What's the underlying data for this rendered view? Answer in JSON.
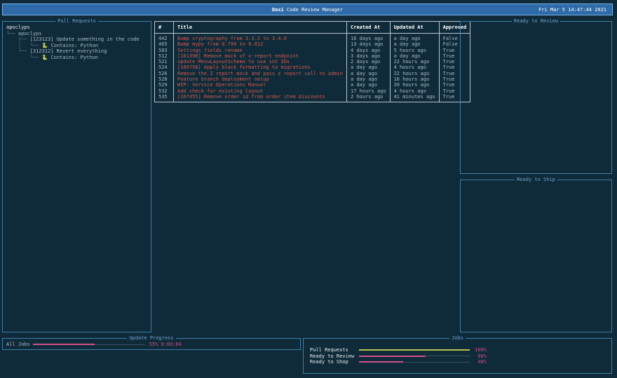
{
  "header": {
    "app_name": "Dexi",
    "subtitle": "Code Review Manager",
    "clock": "Fri Mar  5 14:47:44 2021"
  },
  "pull_requests_panel": {
    "title": "Pull Requests",
    "tree": {
      "root": "apoclyps",
      "repo": "apoclyps",
      "branches": [
        {
          "label": "[123123] Update something in the code",
          "contains": "Contains: Python"
        },
        {
          "label": "[312312] Revert everything",
          "contains": "Contains: Python"
        }
      ]
    }
  },
  "table": {
    "headers": [
      "#",
      "Title",
      "Created At",
      "Updated At",
      "Approved"
    ],
    "rows": [
      [
        "442",
        "Bump cryptography from 3.3.2 to 3.4.6",
        "16 days ago",
        "a day ago",
        "False"
      ],
      [
        "465",
        "Bump mypy from 0.790 to 0.812",
        "13 days ago",
        "a day ago",
        "False"
      ],
      [
        "503",
        "Settings fields rename",
        "4 days ago",
        "5 hours ago",
        "True"
      ],
      [
        "512",
        "[161398] Remove mock of x-report endpoint",
        "3 days ago",
        "a day ago",
        "True"
      ],
      [
        "521",
        "update MenuLayoutSchema to use int IDs",
        "2 days ago",
        "22 hours ago",
        "True"
      ],
      [
        "524",
        "[166758] Apply black formatting to migrations",
        "a day ago",
        "4 hours ago",
        "True"
      ],
      [
        "526",
        "Remove the Z report mock and pass z report call to admin",
        "a day ago",
        "22 hours ago",
        "True"
      ],
      [
        "528",
        "Feature branch deployment setup",
        "a day ago",
        "16 hours ago",
        "True"
      ],
      [
        "529",
        "WIP: Service Operations Manual",
        "a day ago",
        "20 hours ago",
        "True"
      ],
      [
        "532",
        "Add check for existing layout",
        "17 hours ago",
        "4 hours ago",
        "True"
      ],
      [
        "535",
        "[167455] Remove order id from order item discounts",
        "2 hours ago",
        "41 minutes ago",
        "True"
      ]
    ]
  },
  "ready_to_review": {
    "title": "Ready to Review"
  },
  "ready_to_ship": {
    "title": "Ready to Ship"
  },
  "update_progress": {
    "title": "Update Progress",
    "label": "All Jobs",
    "progress": 0.55,
    "percent_text": "55%",
    "elapsed": "0:00:04"
  },
  "jobs": {
    "title": "Jobs",
    "items": [
      {
        "label": "Pull Requests",
        "progress": 1.0,
        "percent_text": "100%",
        "color": "#b8c24a"
      },
      {
        "label": "Ready to Review",
        "progress": 0.6,
        "percent_text": "60%",
        "color": "#d0508a"
      },
      {
        "label": "Ready to Shop",
        "progress": 0.4,
        "percent_text": "40%",
        "color": "#d0508a"
      }
    ]
  },
  "colors": {
    "background": "#0f2a38",
    "header": "#2e6aa7",
    "border": "#3f7fa8",
    "title_red": "#d55a50",
    "progress_pink": "#d0508a",
    "progress_green": "#b8c24a"
  }
}
